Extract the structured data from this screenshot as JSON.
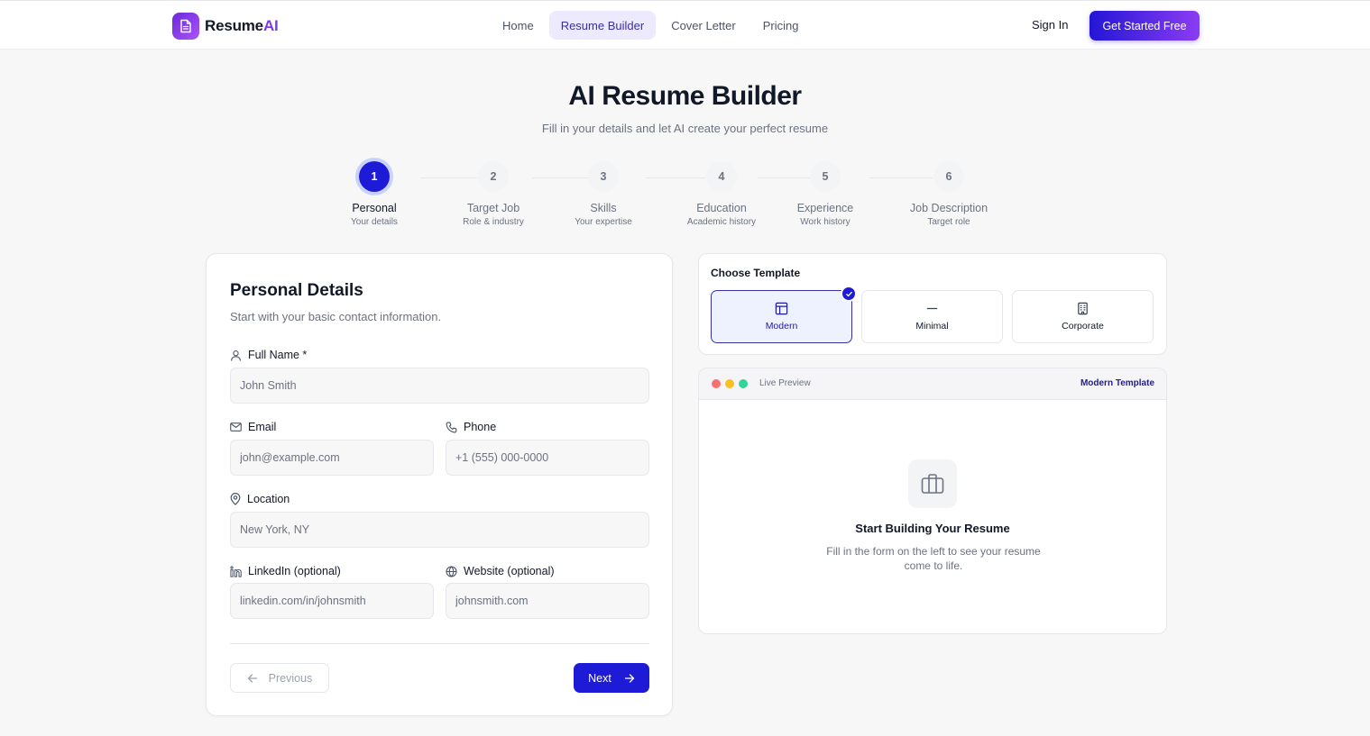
{
  "brand": {
    "name": "Resume",
    "accent": "AI",
    "icon": "document-icon"
  },
  "nav": {
    "links": [
      {
        "label": "Home",
        "active": false
      },
      {
        "label": "Resume Builder",
        "active": true
      },
      {
        "label": "Cover Letter",
        "active": false
      },
      {
        "label": "Pricing",
        "active": false
      }
    ],
    "sign_in": "Sign In",
    "cta": "Get Started Free"
  },
  "hero": {
    "title": "AI Resume Builder",
    "subtitle": "Fill in your details and let AI create your perfect resume"
  },
  "steps": [
    {
      "number": "1",
      "label": "Personal",
      "sub": "Your details",
      "active": true
    },
    {
      "number": "2",
      "label": "Target Job",
      "sub": "Role & industry",
      "active": false
    },
    {
      "number": "3",
      "label": "Skills",
      "sub": "Your expertise",
      "active": false
    },
    {
      "number": "4",
      "label": "Education",
      "sub": "Academic history",
      "active": false
    },
    {
      "number": "5",
      "label": "Experience",
      "sub": "Work history",
      "active": false
    },
    {
      "number": "6",
      "label": "Job Description",
      "sub": "Target role",
      "active": false
    }
  ],
  "form": {
    "title": "Personal Details",
    "subtitle": "Start with your basic contact information.",
    "fields": {
      "full_name": {
        "label": "Full Name *",
        "placeholder": "John Smith",
        "value": "",
        "icon": "user-icon"
      },
      "email": {
        "label": "Email",
        "placeholder": "john@example.com",
        "value": "",
        "icon": "mail-icon"
      },
      "phone": {
        "label": "Phone",
        "placeholder": "+1 (555) 000-0000",
        "value": "",
        "icon": "phone-icon"
      },
      "location": {
        "label": "Location",
        "placeholder": "New York, NY",
        "value": "",
        "icon": "map-pin-icon"
      },
      "linkedin": {
        "label": "LinkedIn (optional)",
        "placeholder": "linkedin.com/in/johnsmith",
        "value": "",
        "icon": "linkedin-icon"
      },
      "website": {
        "label": "Website (optional)",
        "placeholder": "johnsmith.com",
        "value": "",
        "icon": "globe-icon"
      }
    },
    "previous_label": "Previous",
    "next_label": "Next"
  },
  "templates": {
    "heading": "Choose Template",
    "options": [
      {
        "label": "Modern",
        "icon": "layout-icon",
        "selected": true
      },
      {
        "label": "Minimal",
        "icon": "minus-icon",
        "selected": false
      },
      {
        "label": "Corporate",
        "icon": "building-icon",
        "selected": false
      }
    ]
  },
  "preview": {
    "label": "Live Preview",
    "template_name": "Modern Template",
    "empty_title": "Start Building Your Resume",
    "empty_desc": "Fill in the form on the left to see your resume come to life.",
    "icon": "briefcase-icon"
  },
  "colors": {
    "primary": "#1e1bd6",
    "brand_gradient_start": "#6d28d9",
    "brand_gradient_end": "#a855f7",
    "dot_red": "#f87171",
    "dot_yellow": "#fbbf24",
    "dot_green": "#34d399"
  }
}
